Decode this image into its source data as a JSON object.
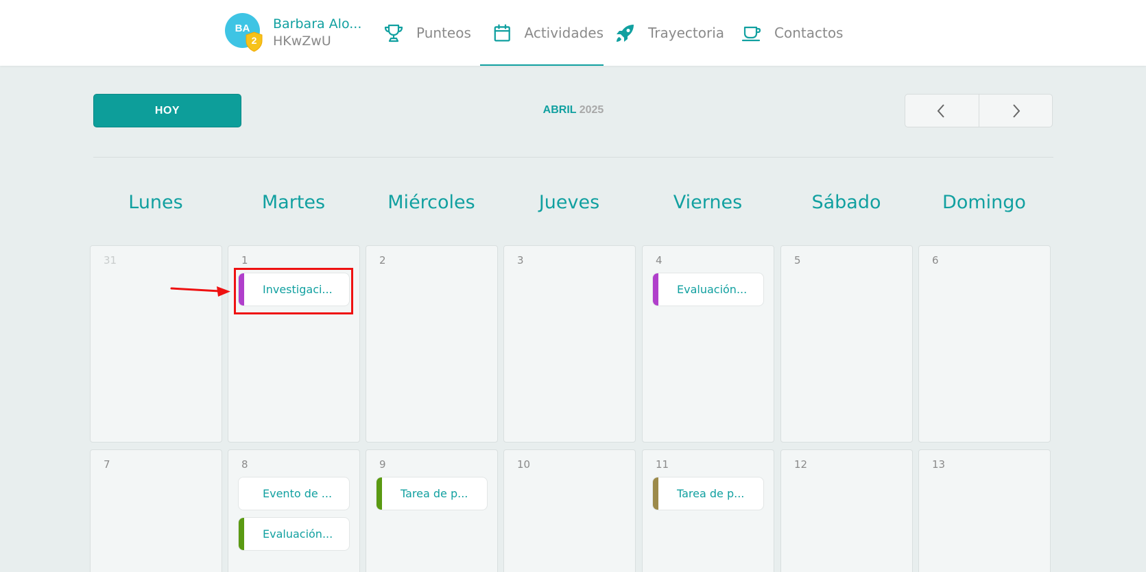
{
  "profile": {
    "initials": "BA",
    "level": "2",
    "name": "Barbara Alo...",
    "code": "HKwZwU"
  },
  "nav": [
    {
      "label": "Punteos",
      "icon": "trophy-icon"
    },
    {
      "label": "Actividades",
      "icon": "calendar-icon",
      "active": true
    },
    {
      "label": "Trayectoria",
      "icon": "rocket-icon"
    },
    {
      "label": "Contactos",
      "icon": "coffee-cup-icon"
    }
  ],
  "toolbar": {
    "today_label": "HOY",
    "month": "ABRIL",
    "year": "2025"
  },
  "weekdays": [
    "Lunes",
    "Martes",
    "Miércoles",
    "Jueves",
    "Viernes",
    "Sábado",
    "Domingo"
  ],
  "weeks": [
    [
      {
        "day": "31",
        "other_month": true,
        "events": []
      },
      {
        "day": "1",
        "events": [
          {
            "label": "Investigaci...",
            "color": "#b03fcb"
          }
        ]
      },
      {
        "day": "2",
        "events": []
      },
      {
        "day": "3",
        "events": []
      },
      {
        "day": "4",
        "events": [
          {
            "label": "Evaluación...",
            "color": "#b03fcb"
          }
        ]
      },
      {
        "day": "5",
        "events": []
      },
      {
        "day": "6",
        "events": []
      }
    ],
    [
      {
        "day": "7",
        "events": []
      },
      {
        "day": "8",
        "events": [
          {
            "label": "Evento de ...",
            "color": "#ffffff"
          },
          {
            "label": "Evaluación...",
            "color": "#5a9a12"
          }
        ]
      },
      {
        "day": "9",
        "events": [
          {
            "label": "Tarea de p...",
            "color": "#5a9a12"
          }
        ]
      },
      {
        "day": "10",
        "events": []
      },
      {
        "day": "11",
        "events": [
          {
            "label": "Tarea de p...",
            "color": "#9c8a4a"
          }
        ]
      },
      {
        "day": "12",
        "events": []
      },
      {
        "day": "13",
        "events": []
      }
    ]
  ],
  "colors": {
    "accent": "#11a0a0",
    "highlight": "#ee1111"
  }
}
